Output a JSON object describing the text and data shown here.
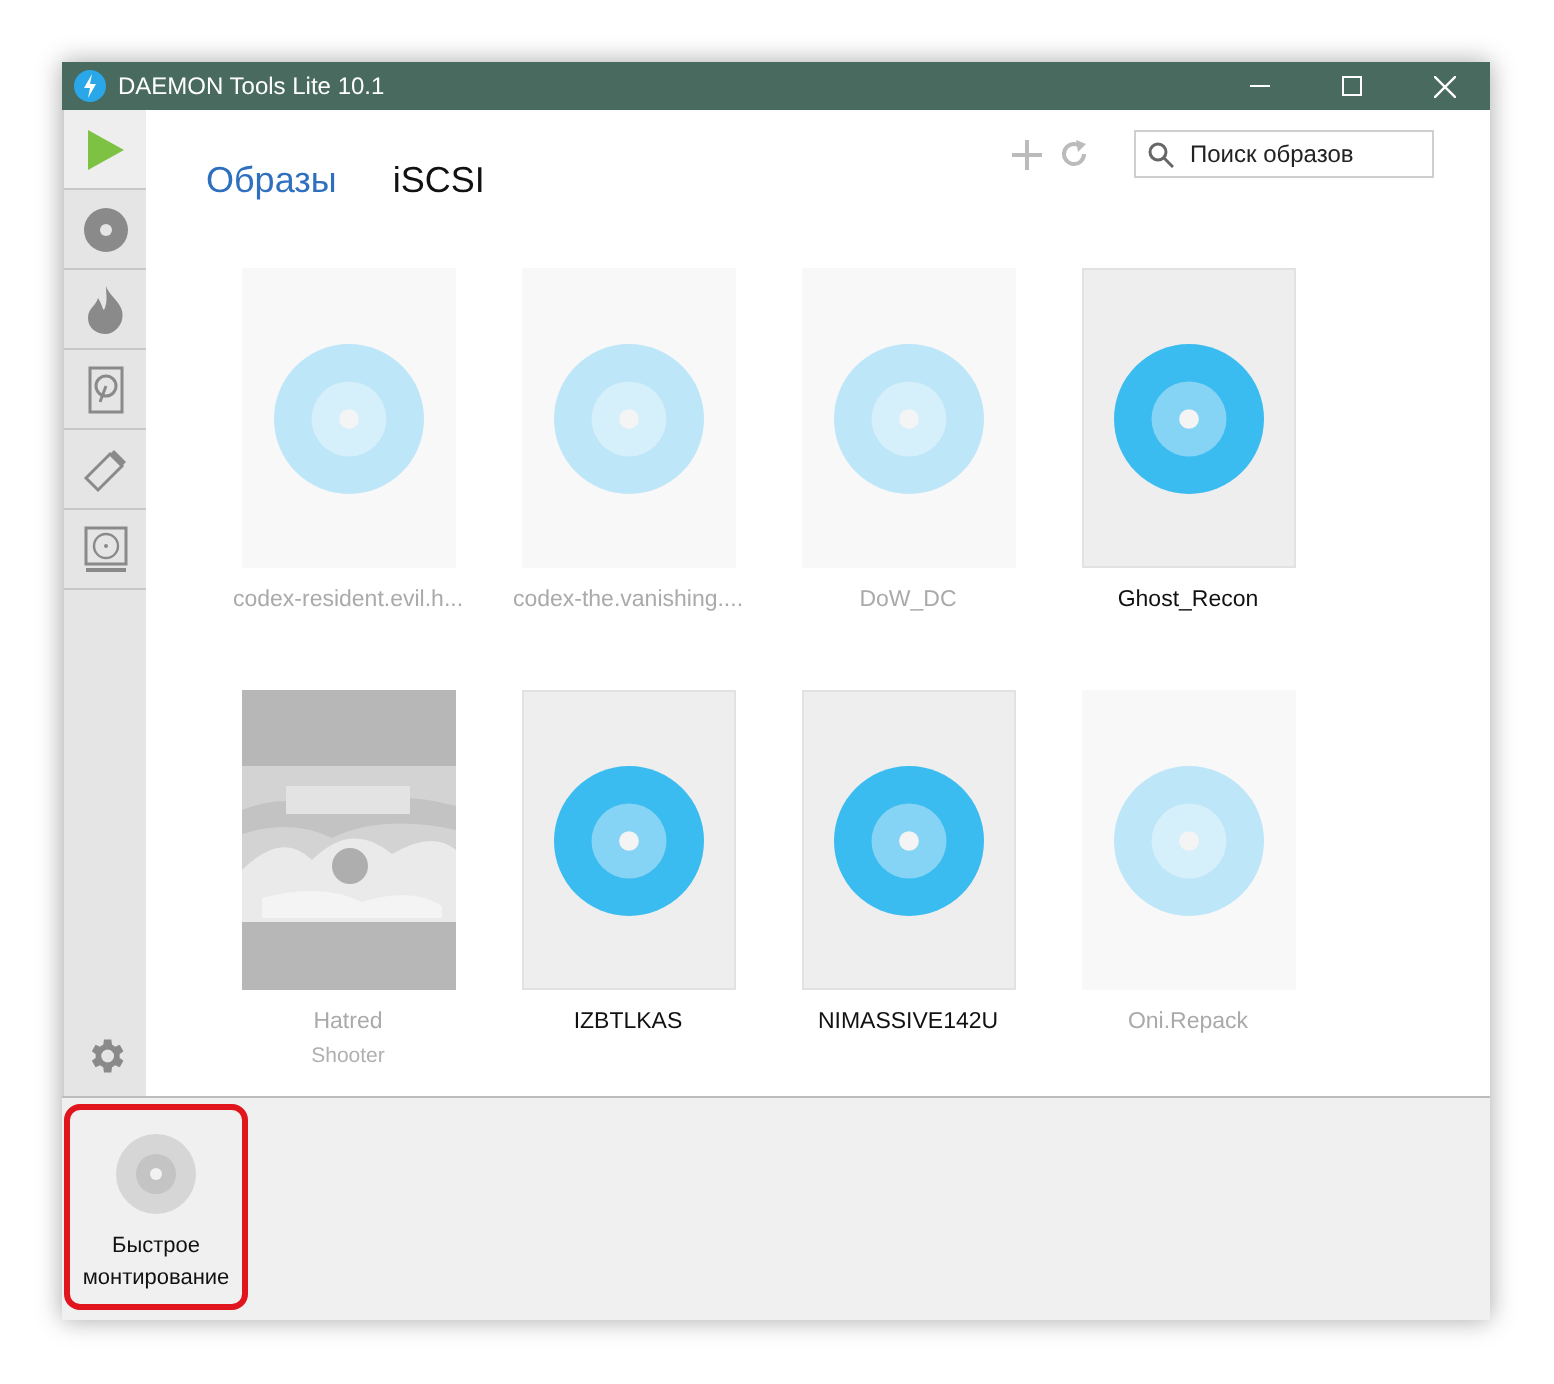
{
  "window": {
    "title": "DAEMON Tools Lite 10.1"
  },
  "tabs": [
    {
      "label": "Образы",
      "selected": true
    },
    {
      "label": "iSCSI",
      "selected": false
    }
  ],
  "search": {
    "placeholder": "Поиск образов"
  },
  "sidebar": {
    "items": [
      {
        "kind": "play",
        "selected": true
      },
      {
        "kind": "disc",
        "selected": false
      },
      {
        "kind": "flame",
        "selected": false
      },
      {
        "kind": "hdd",
        "selected": false
      },
      {
        "kind": "usb",
        "selected": false
      },
      {
        "kind": "drive",
        "selected": false
      }
    ]
  },
  "images": [
    {
      "name": "codex-resident.evil.h...",
      "kind": "disc",
      "available": false
    },
    {
      "name": "codex-the.vanishing....",
      "kind": "disc",
      "available": false
    },
    {
      "name": "DoW_DC",
      "kind": "disc",
      "available": false
    },
    {
      "name": "Ghost_Recon",
      "kind": "disc",
      "available": true
    },
    {
      "name": "Hatred",
      "subtitle": "Shooter",
      "kind": "picture",
      "available": false
    },
    {
      "name": "IZBTLKAS",
      "kind": "disc",
      "available": true
    },
    {
      "name": "NIMASSIVE142U",
      "kind": "disc",
      "available": true
    },
    {
      "name": "Oni.Repack",
      "kind": "disc",
      "available": false
    }
  ],
  "quick_mount": {
    "label": "Быстрое монтирование",
    "highlighted": true
  }
}
